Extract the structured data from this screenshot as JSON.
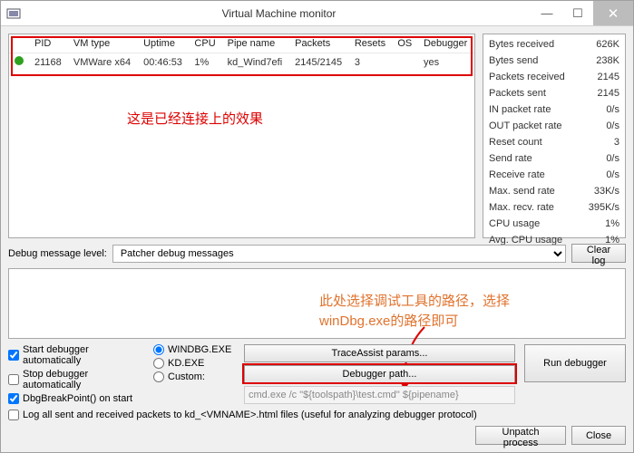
{
  "window": {
    "title": "Virtual Machine monitor"
  },
  "vm_table": {
    "headers": {
      "pid": "PID",
      "vmtype": "VM type",
      "uptime": "Uptime",
      "cpu": "CPU",
      "pipe": "Pipe name",
      "packets": "Packets",
      "resets": "Resets",
      "os": "OS",
      "debugger": "Debugger"
    },
    "row": {
      "pid": "21168",
      "vmtype": "VMWare x64",
      "uptime": "00:46:53",
      "cpu": "1%",
      "pipe": "kd_Wind7efi",
      "packets": "2145/2145",
      "resets": "3",
      "os": "",
      "debugger": "yes"
    }
  },
  "annotations": {
    "connected": "这是已经连接上的效果",
    "debugger_path_1": "此处选择调试工具的路径，选择",
    "debugger_path_2": "winDbg.exe的路径即可"
  },
  "stats": {
    "bytes_received": {
      "label": "Bytes received",
      "value": "626K"
    },
    "bytes_send": {
      "label": "Bytes send",
      "value": "238K"
    },
    "packets_received": {
      "label": "Packets received",
      "value": "2145"
    },
    "packets_sent": {
      "label": "Packets sent",
      "value": "2145"
    },
    "in_packet_rate": {
      "label": "IN packet rate",
      "value": "0/s"
    },
    "out_packet_rate": {
      "label": "OUT packet rate",
      "value": "0/s"
    },
    "reset_count": {
      "label": "Reset count",
      "value": "3"
    },
    "send_rate": {
      "label": "Send rate",
      "value": "0/s"
    },
    "receive_rate": {
      "label": "Receive rate",
      "value": "0/s"
    },
    "max_send_rate": {
      "label": "Max. send rate",
      "value": "33K/s"
    },
    "max_recv_rate": {
      "label": "Max. recv. rate",
      "value": "395K/s"
    },
    "cpu_usage": {
      "label": "CPU usage",
      "value": "1%"
    },
    "avg_cpu_usage": {
      "label": "Avg. CPU usage",
      "value": "1%"
    }
  },
  "dbglevel": {
    "label": "Debug message level:",
    "value": "Patcher debug messages",
    "clear_btn": "Clear log"
  },
  "options": {
    "start_auto": "Start debugger automatically",
    "stop_auto": "Stop debugger automatically",
    "dbgbreak": "DbgBreakPoint() on start",
    "windbg": "WINDBG.EXE",
    "kd": "KD.EXE",
    "custom": "Custom:",
    "custom_value": "cmd.exe /c \"${toolspath}\\test.cmd\" ${pipename}",
    "trace_btn": "TraceAssist params...",
    "debugger_path_btn": "Debugger path...",
    "run_btn": "Run debugger",
    "logall": "Log all sent and received packets to kd_<VMNAME>.html files (useful for analyzing debugger protocol)"
  },
  "footer": {
    "unpatch": "Unpatch process",
    "close": "Close"
  }
}
